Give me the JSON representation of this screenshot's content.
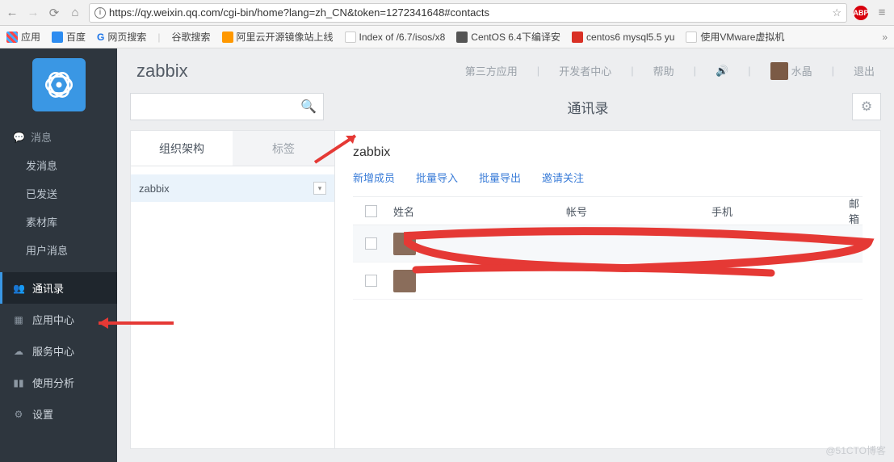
{
  "browser": {
    "url": "https://qy.weixin.qq.com/cgi-bin/home?lang=zh_CN&token=1272341648#contacts",
    "abp": "ABP"
  },
  "bookmarks": {
    "apps": "应用",
    "items": [
      "百度",
      "网页搜索",
      "谷歌搜索",
      "阿里云开源镜像站上线",
      "Index of /6.7/isos/x8",
      "CentOS 6.4下编译安",
      "centos6 mysql5.5 yu",
      "使用VMware虚拟机"
    ]
  },
  "sidebar": {
    "msg_head": "消息",
    "msg_items": [
      "发消息",
      "已发送",
      "素材库",
      "用户消息"
    ],
    "top": [
      "通讯录",
      "应用中心",
      "服务中心",
      "使用分析",
      "设置"
    ]
  },
  "topbar": {
    "brand": "zabbix",
    "items": [
      "第三方应用",
      "开发者中心",
      "帮助"
    ],
    "user": "水晶",
    "logout": "退出"
  },
  "page": {
    "title": "通讯录",
    "search_placeholder": ""
  },
  "tabs": {
    "org": "组织架构",
    "tag": "标签"
  },
  "tree": {
    "root": "zabbix"
  },
  "content": {
    "org_name": "zabbix",
    "actions": [
      "新增成员",
      "批量导入",
      "批量导出",
      "邀请关注"
    ],
    "cols": {
      "name": "姓名",
      "acc": "帐号",
      "phone": "手机",
      "mail": "邮箱"
    }
  },
  "watermark": "@51CTO博客"
}
